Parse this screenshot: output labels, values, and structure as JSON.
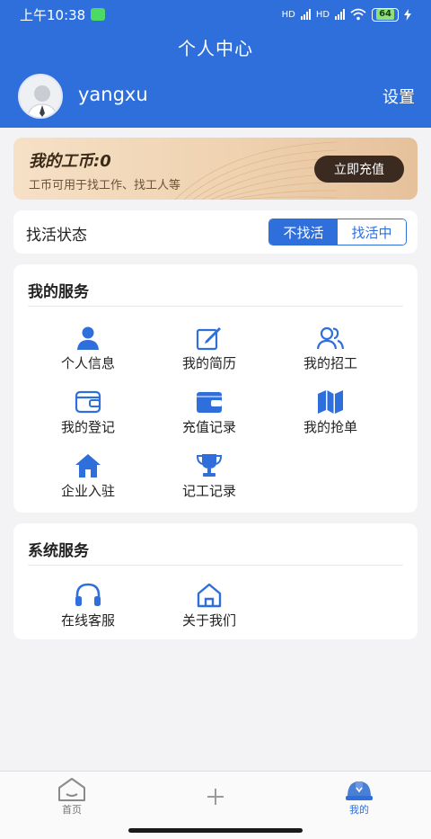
{
  "status_bar": {
    "time": "上午10:38",
    "network_1": "HD",
    "network_2": "HD",
    "battery": "64"
  },
  "header": {
    "title": "个人中心",
    "username": "yangxu",
    "settings_label": "设置"
  },
  "coins": {
    "title": "我的工币:0",
    "description": "工币可用于找工作、找工人等",
    "recharge_label": "立即充值"
  },
  "work_status": {
    "label": "找活状态",
    "options": [
      "不找活",
      "找活中"
    ],
    "selected": "不找活"
  },
  "my_services": {
    "title": "我的服务",
    "items": [
      {
        "label": "个人信息",
        "icon": "person-icon"
      },
      {
        "label": "我的简历",
        "icon": "edit-icon"
      },
      {
        "label": "我的招工",
        "icon": "users-icon"
      },
      {
        "label": "我的登记",
        "icon": "wallet-icon"
      },
      {
        "label": "充值记录",
        "icon": "card-wallet-icon"
      },
      {
        "label": "我的抢单",
        "icon": "map-icon"
      },
      {
        "label": "企业入驻",
        "icon": "home-icon"
      },
      {
        "label": "记工记录",
        "icon": "trophy-icon"
      }
    ]
  },
  "system_services": {
    "title": "系统服务",
    "items": [
      {
        "label": "在线客服",
        "icon": "headset-icon"
      },
      {
        "label": "关于我们",
        "icon": "house-outline-icon"
      }
    ]
  },
  "bottom_nav": [
    {
      "label": "首页",
      "icon": "home-outline-icon",
      "active": false
    },
    {
      "label": "",
      "icon": "plus-icon",
      "active": false
    },
    {
      "label": "我的",
      "icon": "helmet-icon",
      "active": true
    }
  ],
  "colors": {
    "primary": "#2f6fdc",
    "card_gold": "#efd2b0",
    "recharge_button": "#3b2a20",
    "background": "#f3f3f5"
  }
}
